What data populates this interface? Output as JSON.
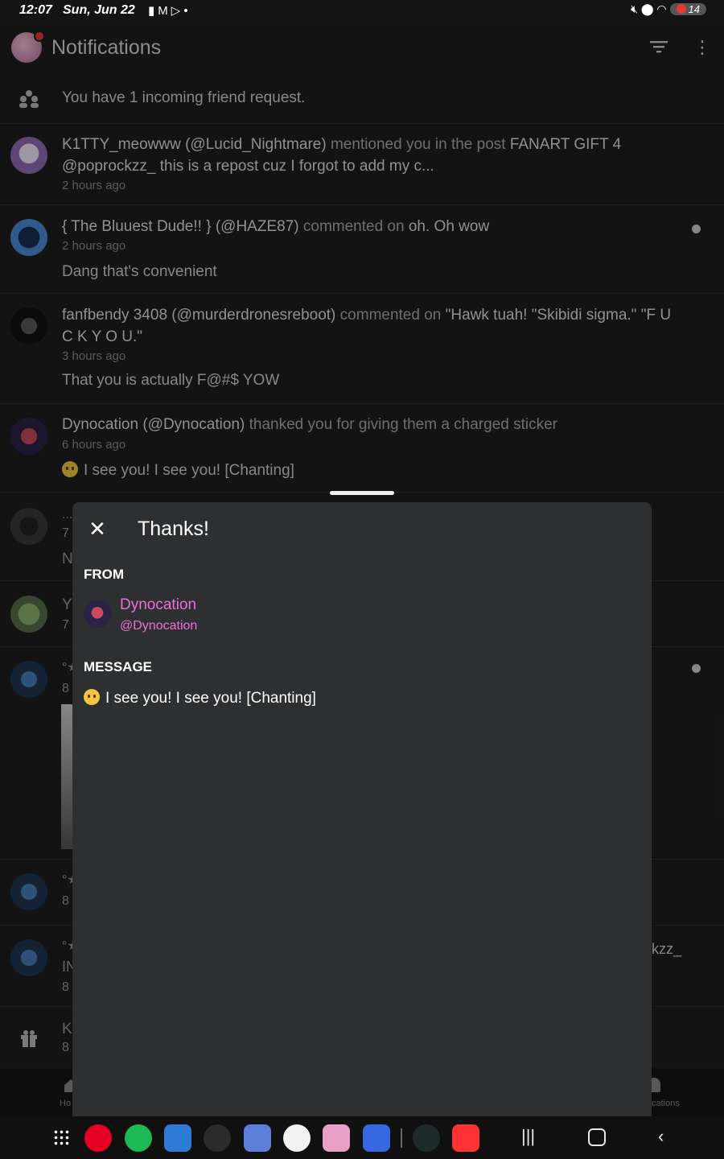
{
  "status_bar": {
    "time": "12:07",
    "date": "Sun, Jun 22",
    "left_icons": [
      "alert-icon",
      "gmail-icon",
      "play-store-icon",
      "dot-icon"
    ],
    "right_icons": [
      "mute-icon",
      "location-icon",
      "wifi-icon"
    ],
    "battery": "14"
  },
  "header": {
    "title": "Notifications",
    "actions": [
      "filter-icon",
      "more-vert-icon"
    ]
  },
  "notifications": [
    {
      "text": "You have 1 incoming friend request.",
      "kind": "friend-request"
    },
    {
      "actor": "K1TTY_meowww (@Lucid_Nightmare)",
      "verb": "mentioned you in the post",
      "target": "FANART GIFT 4 @poprockzz_ this is a repost cuz I forgot to add my c...",
      "time": "2 hours ago"
    },
    {
      "actor": "{ The Bluuest Dude!! } (@HAZE87)",
      "verb": "commented on",
      "target": "oh. Oh wow",
      "time": "2 hours ago",
      "comment": "Dang that's convenient",
      "unread": true
    },
    {
      "actor": "fanfbendy 3408 (@murderdronesreboot)",
      "verb": "commented on",
      "target": "\"Hawk tuah! \"Skibidi sigma.\" \"F U C K Y O U.\"",
      "time": "3 hours ago",
      "comment": "That you is actually F@#$ YOW"
    },
    {
      "actor": "Dynocation (@Dynocation)",
      "verb": "thanked you for giving them a charged sticker",
      "time": "6 hours ago",
      "comment": "I see you! I see you! [Chanting]"
    }
  ],
  "peeking": {
    "r6_a": "...",
    "r6_b": "7",
    "r6_c": "N",
    "r7_a": "Y",
    "r7_b": "7",
    "r8_a": "°★",
    "r8_b": "8",
    "r9_a": "°★",
    "r9_b": "8",
    "r10_a": "°★",
    "r10_b": "IN",
    "r10_c": "8",
    "r10_right": "kzz_",
    "r11_a": "K",
    "r11_b": "8"
  },
  "app_nav": {
    "home": "Ho",
    "notifications": "cations"
  },
  "dock": [
    "apps-grid",
    "pinterest",
    "spotify",
    "picsart",
    "power-app",
    "avatar-app",
    "youtube-music",
    "anime-app",
    "roblox",
    "divider",
    "audio-app",
    "youtube"
  ],
  "sheet": {
    "title": "Thanks!",
    "from_label": "FROM",
    "from_name": "Dynocation",
    "from_handle": "@Dynocation",
    "message_label": "MESSAGE",
    "message": "I see you! I see you! [Chanting]"
  }
}
